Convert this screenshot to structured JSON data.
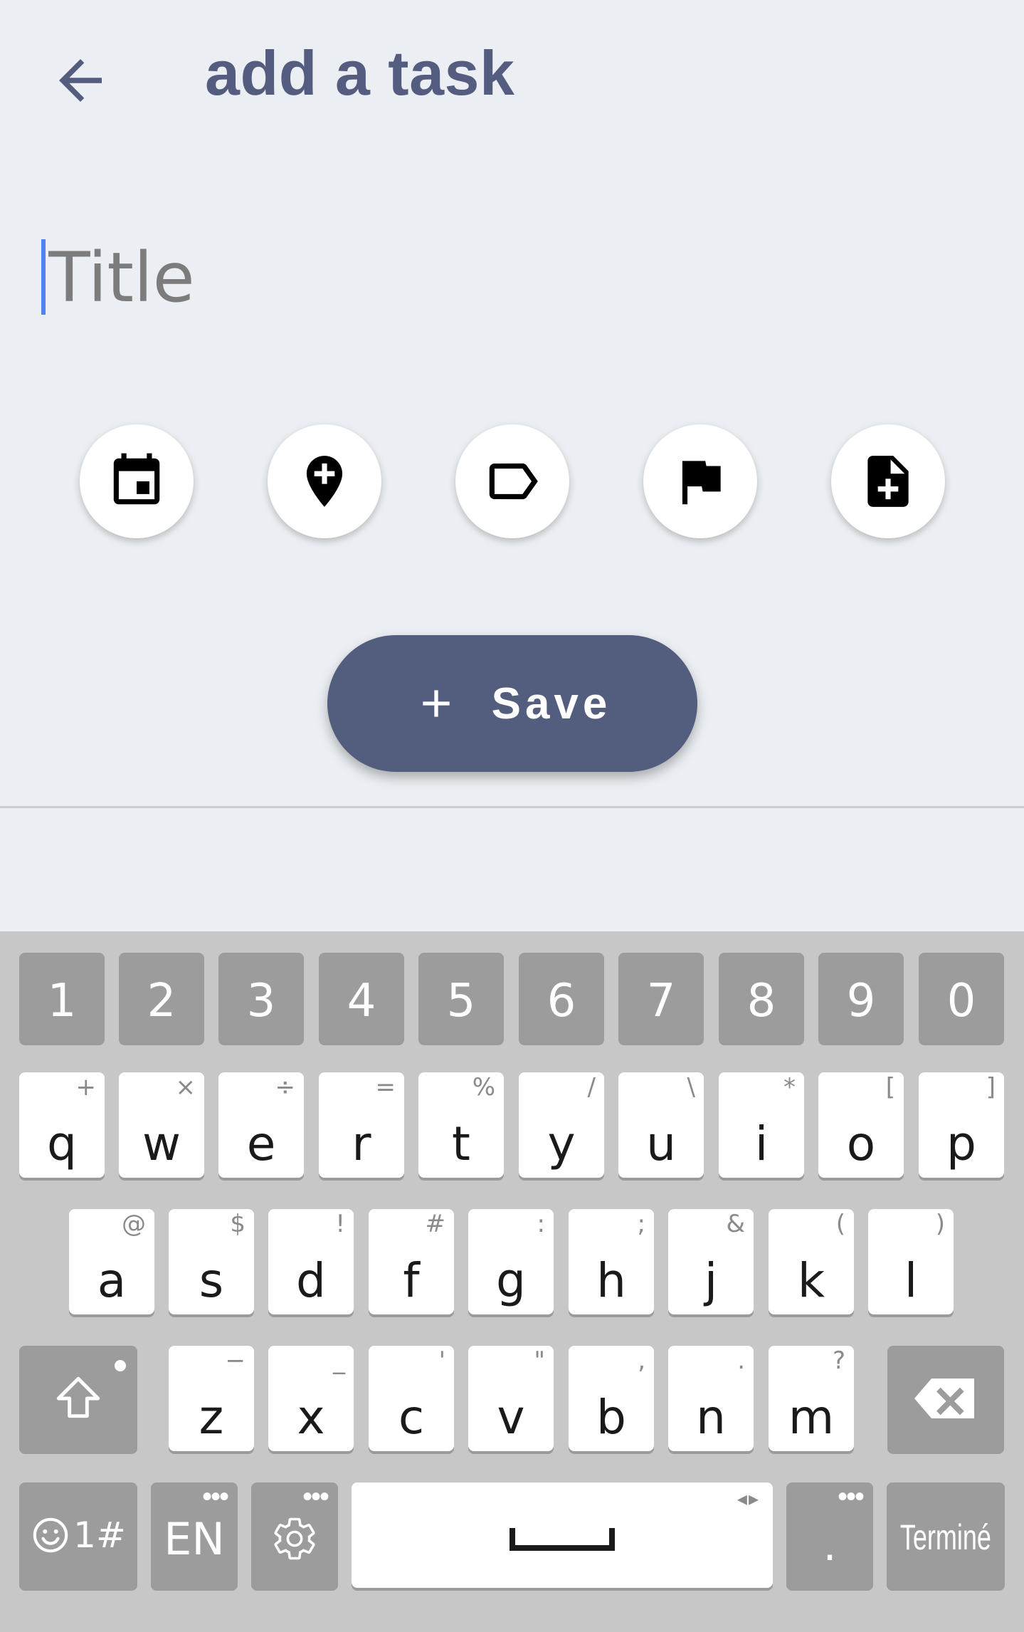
{
  "header": {
    "title": "add a task",
    "back_icon": "arrow-back-icon"
  },
  "form": {
    "title_placeholder": "Title",
    "title_value": ""
  },
  "actions": [
    {
      "name": "calendar-icon"
    },
    {
      "name": "add-location-icon"
    },
    {
      "name": "label-icon"
    },
    {
      "name": "flag-icon"
    },
    {
      "name": "note-add-icon"
    }
  ],
  "save_button": {
    "label": "Save",
    "icon": "plus-icon"
  },
  "colors": {
    "accent": "#535d7e",
    "background": "#ebeef2",
    "caret": "#4a86ec",
    "keyboard_bg": "#c7c7c7",
    "key_grey": "#9c9c9c"
  },
  "keyboard": {
    "numbers": [
      "1",
      "2",
      "3",
      "4",
      "5",
      "6",
      "7",
      "8",
      "9",
      "0"
    ],
    "row1": [
      {
        "key": "q",
        "alt": "+"
      },
      {
        "key": "w",
        "alt": "×"
      },
      {
        "key": "e",
        "alt": "÷"
      },
      {
        "key": "r",
        "alt": "="
      },
      {
        "key": "t",
        "alt": "%"
      },
      {
        "key": "y",
        "alt": "/"
      },
      {
        "key": "u",
        "alt": "\\"
      },
      {
        "key": "i",
        "alt": "*"
      },
      {
        "key": "o",
        "alt": "["
      },
      {
        "key": "p",
        "alt": "]"
      }
    ],
    "row2": [
      {
        "key": "a",
        "alt": "@"
      },
      {
        "key": "s",
        "alt": "$"
      },
      {
        "key": "d",
        "alt": "!"
      },
      {
        "key": "f",
        "alt": "#"
      },
      {
        "key": "g",
        "alt": ":"
      },
      {
        "key": "h",
        "alt": ";"
      },
      {
        "key": "j",
        "alt": "&"
      },
      {
        "key": "k",
        "alt": "("
      },
      {
        "key": "l",
        "alt": ")"
      }
    ],
    "row3": [
      {
        "key": "z",
        "alt": "−"
      },
      {
        "key": "x",
        "alt": "_"
      },
      {
        "key": "c",
        "alt": "'"
      },
      {
        "key": "v",
        "alt": "\""
      },
      {
        "key": "b",
        "alt": ","
      },
      {
        "key": "n",
        "alt": "."
      },
      {
        "key": "m",
        "alt": "?"
      }
    ],
    "symbols_label": "1#",
    "language_label": "EN",
    "period_label": ".",
    "done_label": "Terminé",
    "shift_icon": "shift-icon",
    "backspace_icon": "backspace-icon",
    "emoji_icon": "emoji-icon",
    "settings_icon": "gear-icon",
    "space_icon": "space-bar-icon"
  }
}
